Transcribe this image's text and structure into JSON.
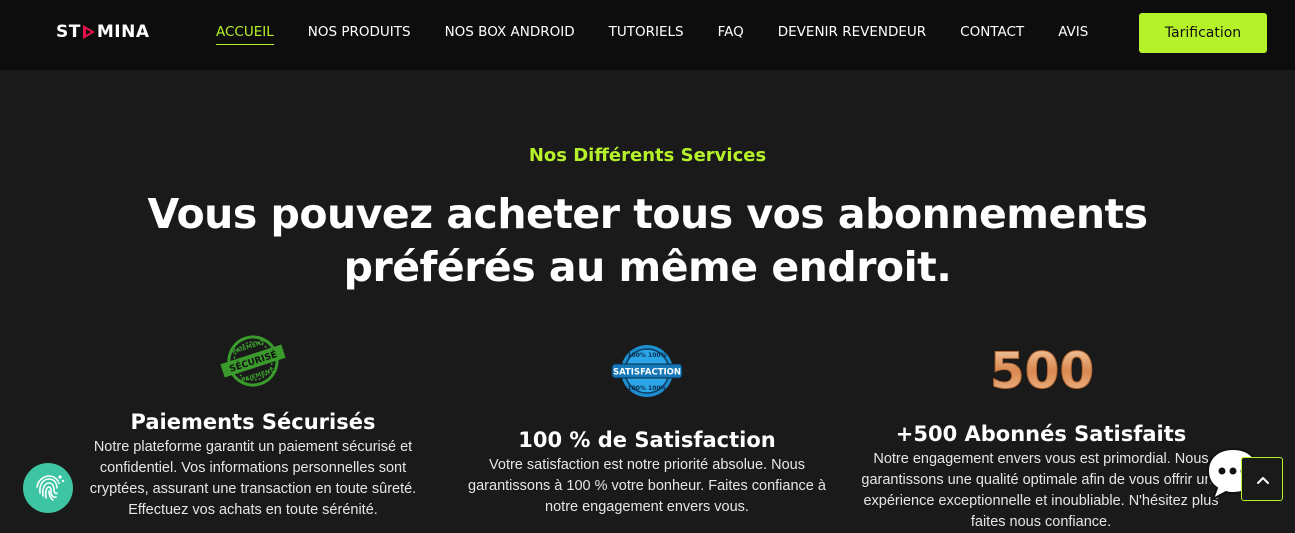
{
  "brand": {
    "logo_left": "ST",
    "logo_right": "MINA",
    "accent": "#b6f22a"
  },
  "nav": {
    "items": [
      {
        "label": "ACCUEIL",
        "active": true
      },
      {
        "label": "NOS PRODUITS"
      },
      {
        "label": "NOS BOX ANDROID"
      },
      {
        "label": "TUTORIELS"
      },
      {
        "label": "FAQ"
      },
      {
        "label": "DEVENIR REVENDEUR"
      },
      {
        "label": "CONTACT"
      },
      {
        "label": "AVIS"
      }
    ],
    "cta_label": "Tarification"
  },
  "hero": {
    "eyebrow": "Nos Différents Services",
    "headline_line1": "Vous pouvez acheter tous vos abonnements",
    "headline_line2": "préférés au même endroit."
  },
  "features": [
    {
      "icon": "paiement-securise-badge-icon",
      "badge_top": "PAIEMENT",
      "badge_mid": "SÉCURISÉ",
      "badge_bottom": "PAIEMENT",
      "title": "Paiements Sécurisés",
      "text": "Notre plateforme garantit un paiement sécurisé et confidentiel. Vos informations personnelles sont cryptées, assurant une transaction en toute sûreté. Effectuez vos achats en toute sérénité."
    },
    {
      "icon": "satisfaction-badge-icon",
      "badge_top": "100% 100%",
      "badge_mid": "SATISFACTION",
      "badge_bottom": "100% 100%",
      "title": "100 % de Satisfaction",
      "text": "Votre satisfaction est notre priorité absolue. Nous garantissons à 100 % votre bonheur. Faites confiance à notre engagement envers vous."
    },
    {
      "icon": "500-number-icon",
      "badge_mid": "500",
      "title": "+500 Abonnés Satisfaits",
      "text": "Notre engagement envers vous est primordial. Nous garantissons une qualité optimale afin de vous offrir une expérience exceptionnelle et inoubliable. N'hésitez plus faites nous confiance."
    }
  ]
}
